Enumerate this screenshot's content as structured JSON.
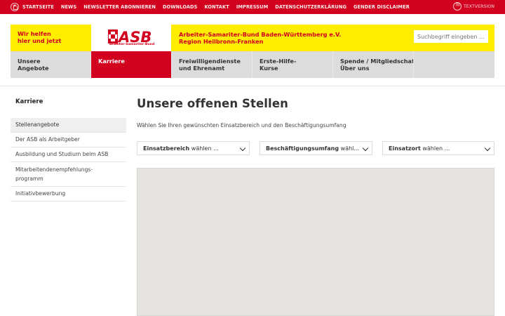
{
  "topbar": {
    "links": [
      "STARTSEITE",
      "NEWS",
      "NEWSLETTER ABONNIEREN",
      "DOWNLOADS",
      "KONTAKT",
      "IMPRESSUM",
      "DATENSCHUTZERKLÄRUNG",
      "GENDER DISCLAIMER"
    ],
    "textversion": "TEXTVERSION"
  },
  "header": {
    "slogan_line1": "Wir helfen",
    "slogan_line2": "hier und jetzt",
    "logo_text": "ASB",
    "logo_subtext": "Arbeiter-Samariter-Bund",
    "org_line1": "Arbeiter-Samariter-Bund Baden-Württemberg e.V.",
    "org_line2": "Region Heilbronn-Franken",
    "search_placeholder": "Suchbegriff eingeben ..."
  },
  "nav": {
    "items": [
      {
        "line1": "Unsere",
        "line2": "Angebote"
      },
      {
        "line1": "Karriere",
        "line2": ""
      },
      {
        "line1": "Freiwilligendienste",
        "line2": "und Ehrenamt"
      },
      {
        "line1": "Erste-Hilfe-",
        "line2": "Kurse"
      },
      {
        "line1": "Spende / Mitgliedschaft",
        "line2": "Über uns"
      }
    ]
  },
  "sidebar": {
    "title": "Karriere",
    "items": [
      {
        "label": "Stellenangebote"
      },
      {
        "label": "Der ASB als Arbeitgeber"
      },
      {
        "label": "Ausbildung und Studium beim ASB"
      },
      {
        "label1": "Mitarbeitendenempfehlungs-",
        "label2": "programm"
      },
      {
        "label": "Initiativbewerbung"
      }
    ]
  },
  "main": {
    "title": "Unsere offenen Stellen",
    "intro": "Wählen Sie Ihren gewünschten Einsatzbereich und den Beschäftigungsumfang",
    "filters": [
      {
        "label": "Einsatzbereich",
        "hint": "wählen ..."
      },
      {
        "label": "Beschäftigungsumfang",
        "hint": "wähl..."
      },
      {
        "label": "Einsatzort",
        "hint": "wählen ..."
      }
    ]
  },
  "colors": {
    "brand_red": "#d2001e",
    "brand_yellow": "#ffed00",
    "nav_gray": "#dcdcdc"
  },
  "icons": [
    "home-icon",
    "textversion-icon",
    "chevron-down-icon"
  ]
}
